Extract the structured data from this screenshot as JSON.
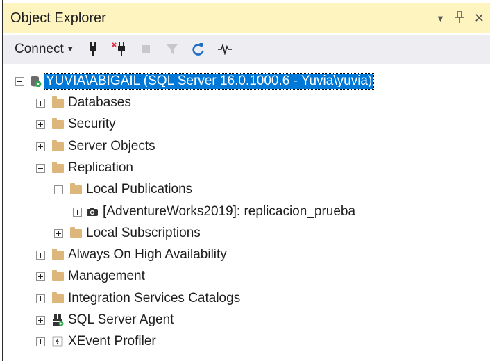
{
  "window": {
    "title": "Object Explorer",
    "buttons": {
      "dropdown": "▼",
      "pin": "ᛘ",
      "close": "✕"
    }
  },
  "toolbar": {
    "connect_label": "Connect",
    "tools": [
      "connect-icon",
      "disconnect-icon",
      "stop-icon",
      "filter-icon",
      "refresh-icon",
      "activity-monitor-icon"
    ]
  },
  "colors": {
    "title_bg": "#fdf4bf",
    "toolbar_bg": "#eeeef2",
    "selection": "#0078d7",
    "folder": "#dcb67a",
    "refresh_blue": "#1e6fc4"
  },
  "tree": [
    {
      "label": "YUVIA\\ABIGAIL (SQL Server 16.0.1000.6 - Yuvia\\yuvia)",
      "level": 0,
      "expanded": true,
      "icon": "server-icon",
      "selected": true
    },
    {
      "label": "Databases",
      "level": 1,
      "expanded": false,
      "icon": "folder-icon"
    },
    {
      "label": "Security",
      "level": 1,
      "expanded": false,
      "icon": "folder-icon"
    },
    {
      "label": "Server Objects",
      "level": 1,
      "expanded": false,
      "icon": "folder-icon"
    },
    {
      "label": "Replication",
      "level": 1,
      "expanded": true,
      "icon": "folder-icon"
    },
    {
      "label": "Local Publications",
      "level": 2,
      "expanded": true,
      "icon": "folder-icon"
    },
    {
      "label": "[AdventureWorks2019]: replicacion_prueba",
      "level": 3,
      "expanded": false,
      "icon": "publication-camera-icon"
    },
    {
      "label": "Local Subscriptions",
      "level": 2,
      "expanded": false,
      "icon": "folder-icon"
    },
    {
      "label": "Always On High Availability",
      "level": 1,
      "expanded": false,
      "icon": "folder-icon"
    },
    {
      "label": "Management",
      "level": 1,
      "expanded": false,
      "icon": "folder-icon"
    },
    {
      "label": "Integration Services Catalogs",
      "level": 1,
      "expanded": false,
      "icon": "folder-icon"
    },
    {
      "label": "SQL Server Agent",
      "level": 1,
      "expanded": false,
      "icon": "sql-agent-icon"
    },
    {
      "label": "XEvent Profiler",
      "level": 1,
      "expanded": false,
      "icon": "xevent-profiler-icon"
    }
  ]
}
